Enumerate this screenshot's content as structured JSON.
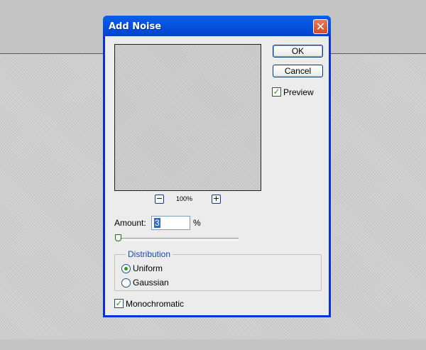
{
  "dialog": {
    "title": "Add Noise",
    "close_glyph": "✕",
    "ok_label": "OK",
    "cancel_label": "Cancel",
    "preview": {
      "label": "Preview",
      "checked": true
    },
    "zoom": {
      "minus": "−",
      "plus": "+",
      "level": "100%"
    },
    "amount": {
      "label": "Amount:",
      "value": "3",
      "unit": "%",
      "slider_fraction": 0.008
    },
    "distribution": {
      "legend": "Distribution",
      "options": [
        {
          "label": "Uniform",
          "selected": true
        },
        {
          "label": "Gaussian",
          "selected": false
        }
      ]
    },
    "monochromatic": {
      "label": "Monochromatic",
      "checked": true
    }
  },
  "colors": {
    "titlebar": "#0654e0",
    "close_button": "#d6492a",
    "check_mark": "#21a121",
    "group_legend": "#1a47b8"
  },
  "icons": {
    "close": "close-icon",
    "check": "check-icon",
    "zoom_out": "zoom-out-icon",
    "zoom_in": "zoom-in-icon"
  }
}
